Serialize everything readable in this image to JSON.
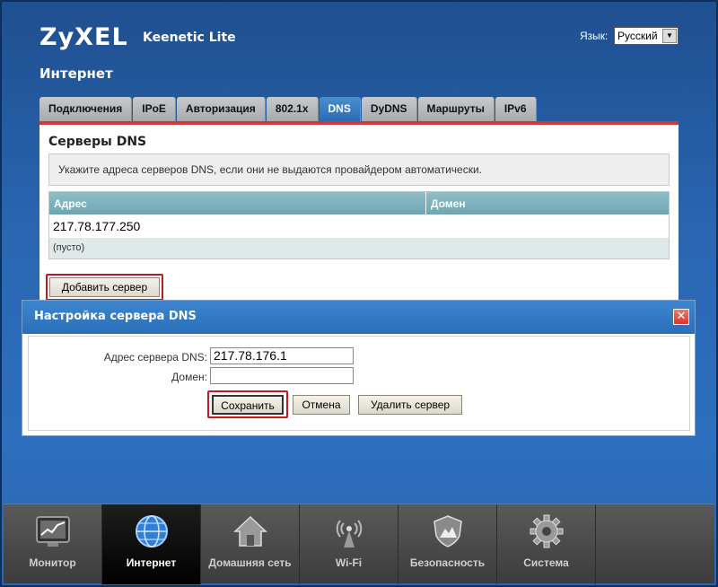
{
  "header": {
    "logo": "ZyXEL",
    "product": "Keenetic Lite",
    "language_label": "Язык:",
    "language_value": "Русский",
    "page_title": "Интернет"
  },
  "tabs": [
    {
      "label": "Подключения",
      "active": false
    },
    {
      "label": "IPoE",
      "active": false
    },
    {
      "label": "Авторизация",
      "active": false
    },
    {
      "label": "802.1x",
      "active": false
    },
    {
      "label": "DNS",
      "active": true
    },
    {
      "label": "DyDNS",
      "active": false
    },
    {
      "label": "Маршруты",
      "active": false
    },
    {
      "label": "IPv6",
      "active": false
    }
  ],
  "main": {
    "section_title": "Серверы DNS",
    "info": "Укажите адреса серверов DNS, если они не выдаются провайдером автоматически.",
    "table": {
      "columns": [
        "Адрес",
        "Домен"
      ],
      "rows": [
        {
          "address": "217.78.177.250",
          "domain": ""
        },
        {
          "address": "(пусто)",
          "domain": ""
        }
      ]
    },
    "add_server_label": "Добавить сервер"
  },
  "dialog": {
    "title": "Настройка сервера DNS",
    "dns_address_label": "Адрес сервера DNS:",
    "dns_address_value": "217.78.176.1",
    "domain_label": "Домен:",
    "domain_value": "",
    "save_label": "Сохранить",
    "cancel_label": "Отмена",
    "delete_label": "Удалить сервер"
  },
  "bottom_nav": [
    {
      "label": "Монитор",
      "icon": "monitor-icon",
      "active": false
    },
    {
      "label": "Интернет",
      "icon": "globe-icon",
      "active": true
    },
    {
      "label": "Домашняя сеть",
      "icon": "home-icon",
      "active": false
    },
    {
      "label": "Wi-Fi",
      "icon": "wifi-antenna-icon",
      "active": false
    },
    {
      "label": "Безопасность",
      "icon": "shield-icon",
      "active": false
    },
    {
      "label": "Система",
      "icon": "gear-icon",
      "active": false
    }
  ],
  "colors": {
    "background": "#2a66b2",
    "active_tab": "#2b6cb0",
    "highlight_red": "#c21b1b",
    "table_header": "#7fb2bd"
  }
}
